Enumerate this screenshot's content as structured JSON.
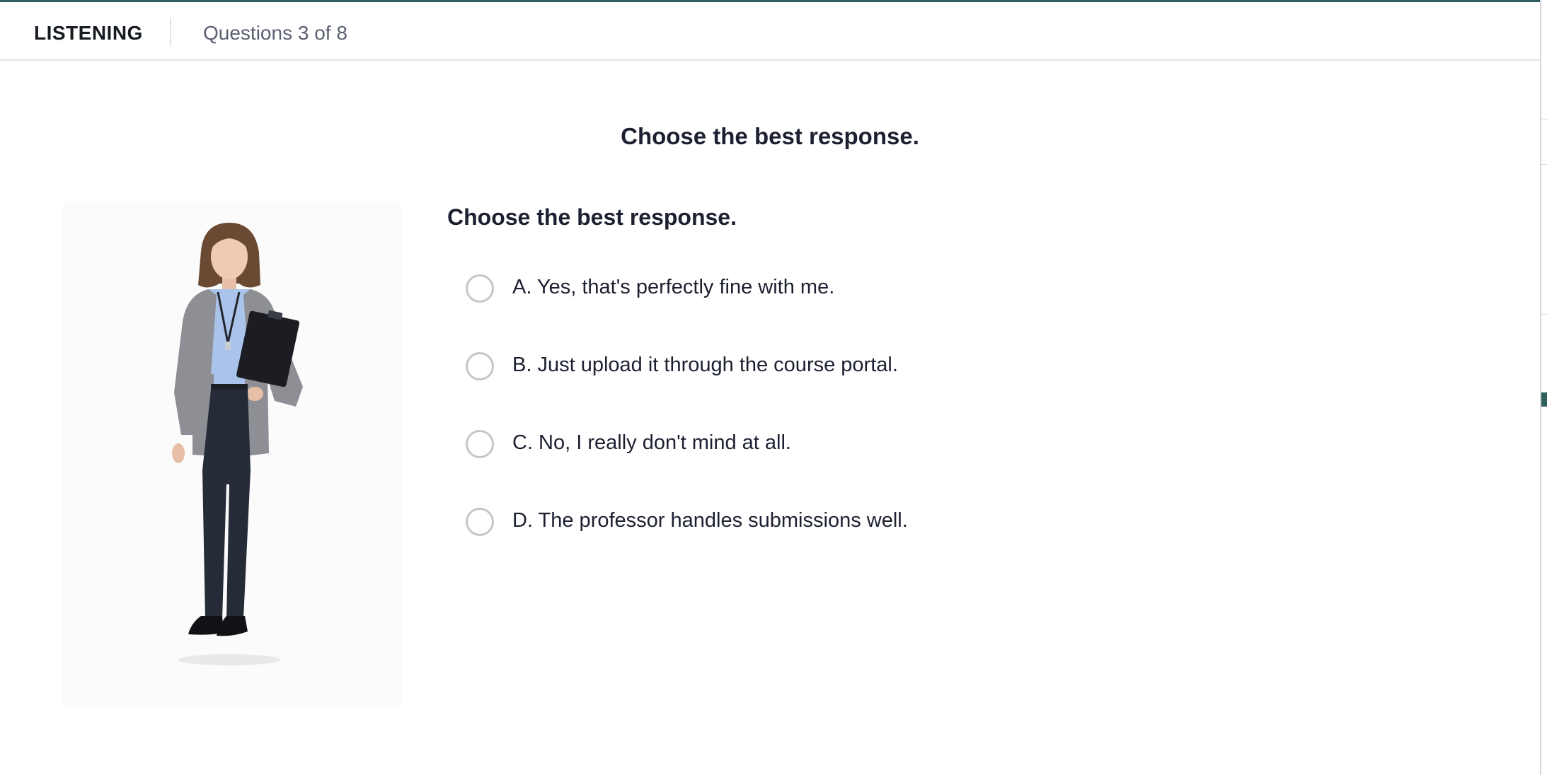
{
  "header": {
    "section": "LISTENING",
    "progress": "Questions 3 of 8"
  },
  "instruction": "Choose the best response.",
  "question": {
    "prompt": "Choose the best response.",
    "options": [
      {
        "label": "A. Yes, that's perfectly fine with me.",
        "selected": false
      },
      {
        "label": "B. Just upload it through the course portal.",
        "selected": false
      },
      {
        "label": "C. No, I really don't mind at all.",
        "selected": false
      },
      {
        "label": "D. The professor handles submissions well.",
        "selected": false
      }
    ]
  },
  "icons": {
    "illustration": "speaker-woman-illustration",
    "radio": "radio-button-unchecked"
  },
  "colors": {
    "accent": "#2f5f5f",
    "text": "#1c2030",
    "muted": "#5a6070",
    "radio_border": "#c6c6c8",
    "divider": "#e3e5ee"
  }
}
